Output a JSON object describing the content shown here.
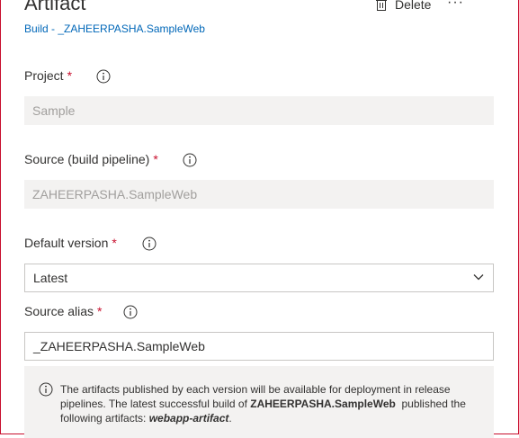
{
  "header": {
    "title": "Artifact",
    "subtitle": "Build - _ZAHEERPASHA.SampleWeb",
    "delete_label": "Delete",
    "more_label": "···"
  },
  "form": {
    "project": {
      "label": "Project",
      "required_mark": "*",
      "value": "Sample"
    },
    "source": {
      "label": "Source (build pipeline)",
      "required_mark": "*",
      "value": "ZAHEERPASHA.SampleWeb"
    },
    "default_version": {
      "label": "Default version",
      "required_mark": "*",
      "value": "Latest"
    },
    "source_alias": {
      "label": "Source alias",
      "required_mark": "*",
      "value": "_ZAHEERPASHA.SampleWeb"
    }
  },
  "info_message": {
    "text_1": "The artifacts published by each version will be available for deployment in release pipelines. The latest successful build of ",
    "build_name": "ZAHEERPASHA.SampleWeb",
    "text_2": "  published the following artifacts: ",
    "artifact_name": "webapp-artifact",
    "text_3": "."
  },
  "icons": {
    "delete": "trash-icon",
    "info": "info-icon",
    "dropdown": "chevron-down-icon"
  },
  "colors": {
    "link": "#0067b8",
    "required": "#c8102e",
    "disabled_field": "#f3f2f1",
    "frame": "#c8102e"
  }
}
